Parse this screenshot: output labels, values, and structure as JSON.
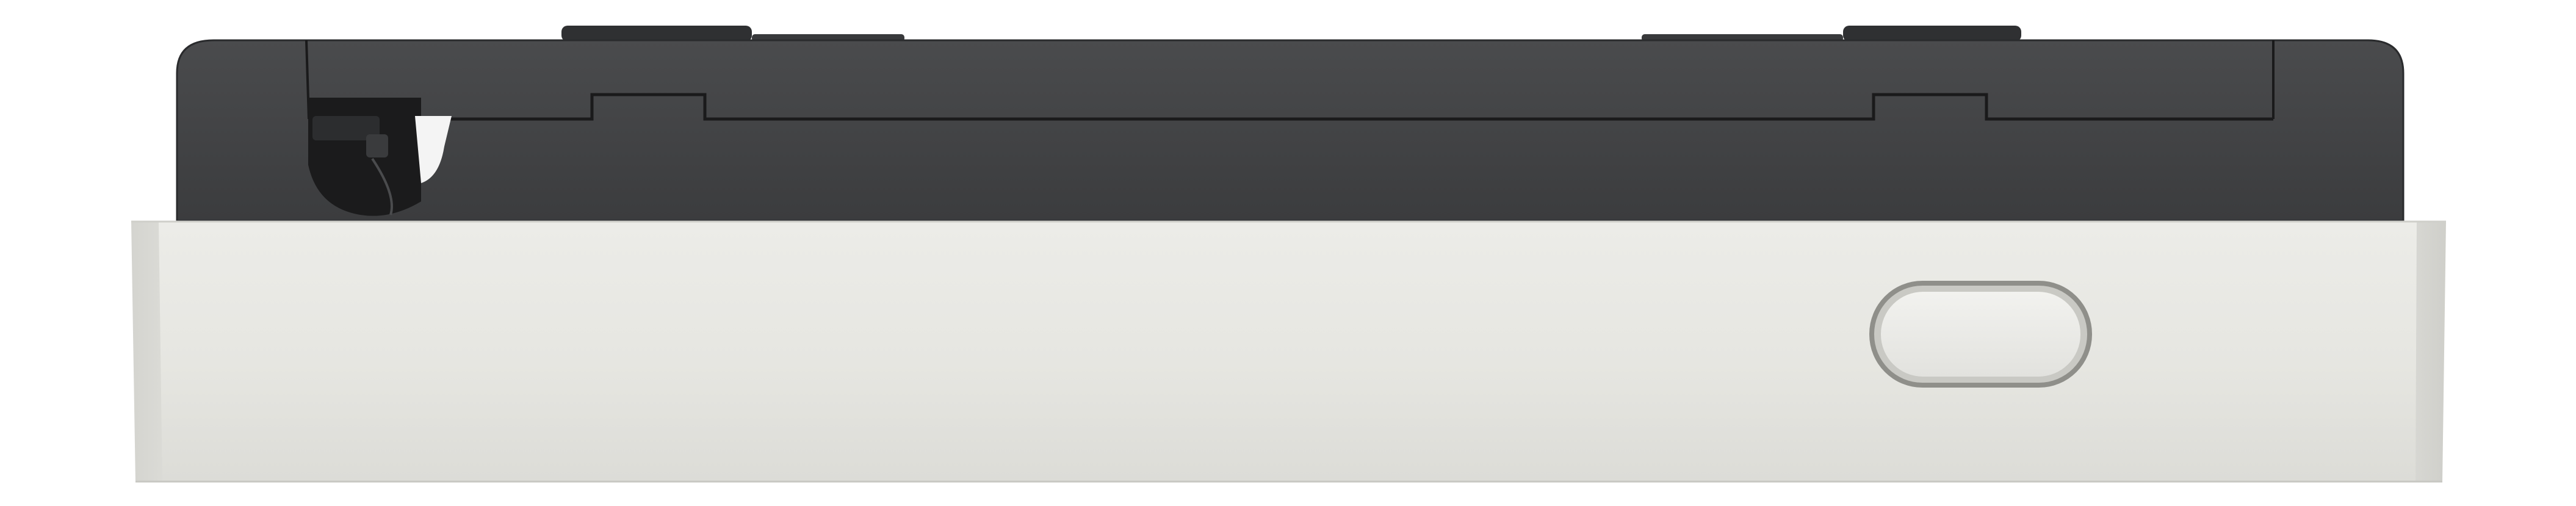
{
  "image": {
    "subject": "device-side-view",
    "colors": {
      "background": "#ffffff",
      "top_body": "#404143",
      "top_body_edge": "#2e2f31",
      "outline": "#1c1c1d",
      "front_panel": "#e6e6e2",
      "front_panel_shadow": "#d9d9d4",
      "button_ring": "#9b9b96",
      "button_face": "#ecece8"
    },
    "parts": {
      "top_knobs": 2,
      "has_side_port": true,
      "has_front_button": true
    }
  }
}
